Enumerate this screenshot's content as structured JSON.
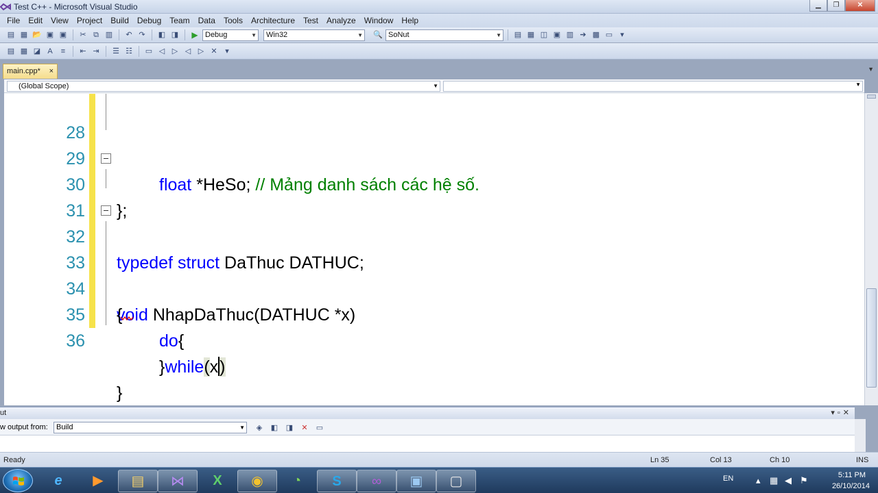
{
  "window": {
    "title": "Test C++ - Microsoft Visual Studio"
  },
  "menu": [
    "File",
    "Edit",
    "View",
    "Project",
    "Build",
    "Debug",
    "Team",
    "Data",
    "Tools",
    "Architecture",
    "Test",
    "Analyze",
    "Window",
    "Help"
  ],
  "toolbar": {
    "config": "Debug",
    "platform": "Win32",
    "find_value": "SoNut"
  },
  "tabs": [
    {
      "label": "main.cpp*",
      "close": "×"
    }
  ],
  "navbar": {
    "scope": "(Global Scope)"
  },
  "code_lines": [
    {
      "num": "28"
    },
    {
      "num": "29"
    },
    {
      "num": "30"
    },
    {
      "num": "31"
    },
    {
      "num": "32"
    },
    {
      "num": "33"
    },
    {
      "num": "34"
    },
    {
      "num": "35"
    },
    {
      "num": "36"
    }
  ],
  "code": {
    "l28_kw": "float",
    "l28_text": " *HeSo; ",
    "l28_comment": "// Mảng danh sách các hệ số.",
    "l29": "};",
    "l30_kw1": "typedef",
    "l30_kw2": "struct",
    "l30_text": " DaThuc DATHUC;",
    "l32_kw": "void",
    "l32_text": " NhapDaThuc(DATHUC *x)",
    "l33": "{",
    "l34_kw": "do",
    "l34_text": "{",
    "l35_brace": "}",
    "l35_kw": "while",
    "l35_open": "(",
    "l35_arg": "x",
    "l35_close": ")",
    "l36": "}"
  },
  "output": {
    "title": "ut",
    "show_from_label": "w output from:",
    "show_from_value": "Build"
  },
  "status": {
    "state": "Ready",
    "ln": "Ln 35",
    "col": "Col 13",
    "ch": "Ch 10",
    "mode": "INS"
  },
  "taskbar": {
    "lang": "EN",
    "time": "5:11 PM",
    "date": "26/10/2014"
  },
  "colors": {
    "keyword": "#0000ff",
    "comment": "#008000",
    "line_number": "#2b91af",
    "change_bar": "#f6e24a",
    "tab_active": "#f5dc8c"
  }
}
